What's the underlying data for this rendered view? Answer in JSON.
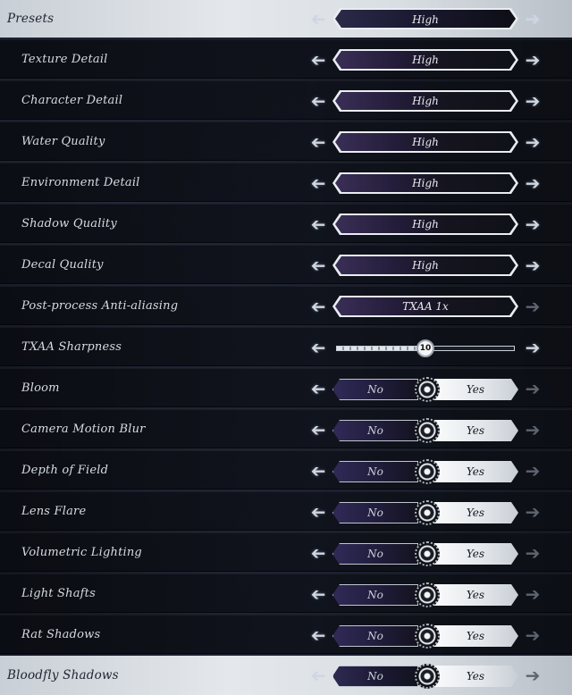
{
  "presets": {
    "label": "Presets",
    "value": "High"
  },
  "rows": [
    {
      "label": "Texture Detail",
      "kind": "selector",
      "value": "High"
    },
    {
      "label": "Character Detail",
      "kind": "selector",
      "value": "High"
    },
    {
      "label": "Water Quality",
      "kind": "selector",
      "value": "High"
    },
    {
      "label": "Environment Detail",
      "kind": "selector",
      "value": "High"
    },
    {
      "label": "Shadow Quality",
      "kind": "selector",
      "value": "High"
    },
    {
      "label": "Decal Quality",
      "kind": "selector",
      "value": "High"
    },
    {
      "label": "Post-process Anti-aliasing",
      "kind": "selector",
      "value": "TXAA 1x"
    },
    {
      "label": "TXAA Sharpness",
      "kind": "slider",
      "value": "10",
      "level": 0.5
    },
    {
      "label": "Bloom",
      "kind": "toggle",
      "no": "No",
      "yes": "Yes"
    },
    {
      "label": "Camera Motion Blur",
      "kind": "toggle",
      "no": "No",
      "yes": "Yes"
    },
    {
      "label": "Depth of Field",
      "kind": "toggle",
      "no": "No",
      "yes": "Yes"
    },
    {
      "label": "Lens Flare",
      "kind": "toggle",
      "no": "No",
      "yes": "Yes"
    },
    {
      "label": "Volumetric Lighting",
      "kind": "toggle",
      "no": "No",
      "yes": "Yes"
    },
    {
      "label": "Light Shafts",
      "kind": "toggle",
      "no": "No",
      "yes": "Yes"
    },
    {
      "label": "Rat Shadows",
      "kind": "toggle",
      "no": "No",
      "yes": "Yes"
    }
  ],
  "bloodfly": {
    "label": "Bloodfly Shadows",
    "no": "No",
    "yes": "Yes"
  },
  "icons": {
    "left": "arrow-left-icon",
    "right": "arrow-right-icon",
    "knob": "gear-knob-icon"
  }
}
